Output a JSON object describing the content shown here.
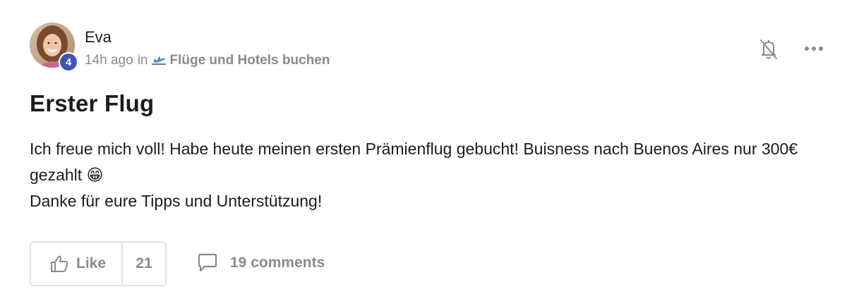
{
  "post": {
    "author": "Eva",
    "level": "4",
    "time": "14h ago",
    "in_text": "in",
    "category_icon": "airplane-departure-icon",
    "category": "Flüge und Hotels buchen",
    "title": "Erster Flug",
    "body_line1": "Ich freue mich voll! Habe heute meinen ersten Prämienflug gebucht! Buisness nach Buenos Aires nur 300€ gezahlt 😁",
    "body_line2": "Danke für eure Tipps und Unterstützung!"
  },
  "actions": {
    "like_label": "Like",
    "like_count": "21",
    "comments_label": "19 comments"
  },
  "colors": {
    "accent_badge": "#3d56b2",
    "muted_text": "#8a8a8a",
    "border": "#e3e3e3"
  }
}
